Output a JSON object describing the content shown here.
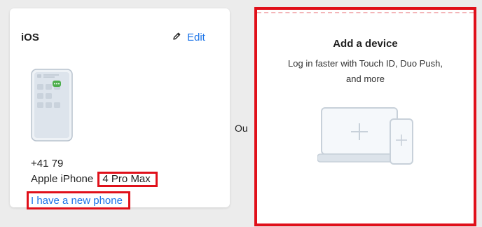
{
  "ios_card": {
    "title": "iOS",
    "edit_label": "Edit",
    "phone_number": "+41 79",
    "device_brand": "Apple iPhone",
    "device_model": "4 Pro Max",
    "new_phone_link": "I have a new phone",
    "icons": {
      "edit": "pencil-icon",
      "phone": "phone-illustration"
    }
  },
  "separator": {
    "label": "Ou"
  },
  "add_device_card": {
    "title": "Add a device",
    "description": "Log in faster with Touch ID, Duo Push, and more",
    "icons": {
      "illustration": "laptop-and-phone-plus-icon"
    }
  },
  "colors": {
    "accent": "#1a73e8",
    "highlight": "#e0101a",
    "background": "#ececec",
    "card": "#ffffff"
  }
}
